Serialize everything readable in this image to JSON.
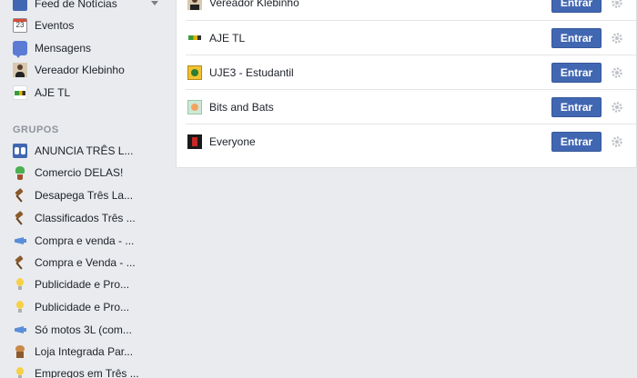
{
  "sidebar": {
    "favorites": [
      {
        "label": "Feed de Notícias",
        "icon": "news-feed-icon"
      },
      {
        "label": "Eventos",
        "icon": "calendar-icon",
        "badge": "23"
      },
      {
        "label": "Mensagens",
        "icon": "messages-icon"
      },
      {
        "label": "Vereador Klebinho",
        "icon": "profile-picture-icon"
      },
      {
        "label": "AJE TL",
        "icon": "aje-logo-icon"
      }
    ],
    "groups_heading": "GRUPOS",
    "groups": [
      {
        "label": "ANUNCIA TRÊS L...",
        "icon": "group-icon"
      },
      {
        "label": "Comercio DELAS!",
        "icon": "plant-icon"
      },
      {
        "label": "Desapega Três La...",
        "icon": "gavel-icon"
      },
      {
        "label": "Classificados Três ...",
        "icon": "gavel-icon"
      },
      {
        "label": "Compra e venda - ...",
        "icon": "megaphone-icon"
      },
      {
        "label": "Compra e Venda - ...",
        "icon": "gavel-icon"
      },
      {
        "label": "Publicidade e Pro...",
        "icon": "lightbulb-icon"
      },
      {
        "label": "Publicidade e Pro...",
        "icon": "lightbulb-icon"
      },
      {
        "label": "Só motos 3L (com...",
        "icon": "megaphone-icon"
      },
      {
        "label": "Loja Integrada Par...",
        "icon": "store-icon"
      },
      {
        "label": "Empregos em Três ...",
        "icon": "lightbulb-icon"
      }
    ]
  },
  "suggested": {
    "rows": [
      {
        "name": "Vereador Klebinho",
        "button": "Entrar"
      },
      {
        "name": "AJE TL",
        "button": "Entrar"
      },
      {
        "name": "UJE3 - Estudantil",
        "button": "Entrar"
      },
      {
        "name": "Bits and Bats",
        "button": "Entrar"
      },
      {
        "name": "Everyone",
        "button": "Entrar"
      }
    ]
  },
  "colors": {
    "primary_button": "#4267b2",
    "background": "#e9ebee"
  }
}
